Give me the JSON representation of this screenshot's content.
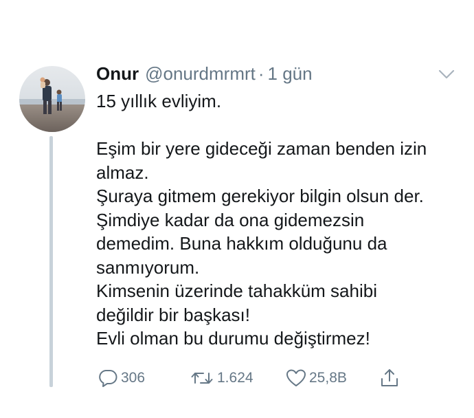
{
  "tweet": {
    "author_name": "Onur",
    "handle": "@onurdmrmrt",
    "separator": "·",
    "time": "1 gün",
    "lines": [
      "15 yıllık evliyim.",
      "",
      "Eşim bir yere gideceği zaman benden izin",
      "almaz.",
      "Şuraya gitmem gerekiyor bilgin olsun der.",
      "Şimdiye kadar da ona gidemezsin",
      "demedim. Buna hakkım olduğunu da",
      "sanmıyorum.",
      "Kimsenin üzerinde tahakküm sahibi",
      "değildir bir başkası!",
      "Evli olman bu durumu değiştirmez!"
    ],
    "replies": "306",
    "retweets": "1.624",
    "likes": "25,8B"
  },
  "icons": {
    "reply": "reply-icon",
    "retweet": "retweet-icon",
    "like": "heart-icon",
    "share": "share-icon",
    "menu": "chevron-down-icon"
  },
  "colors": {
    "text": "#14171a",
    "secondary": "#657786",
    "thread_line": "#c8d2da"
  }
}
